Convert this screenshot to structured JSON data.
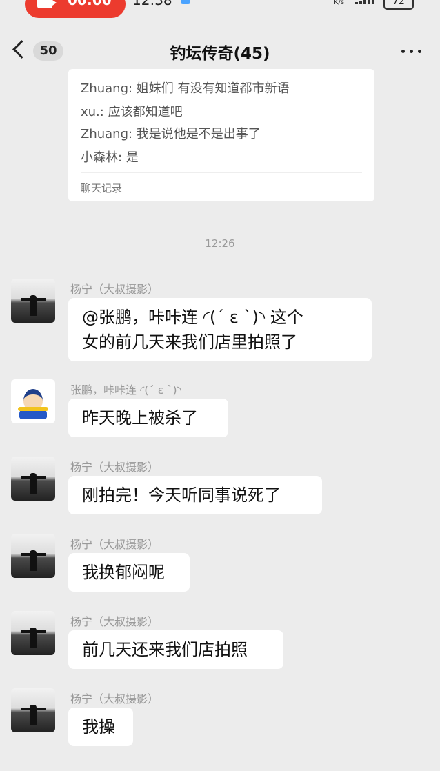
{
  "status_bar": {
    "rec_time": "00:00",
    "clock": "12:38",
    "net_speed": "K/s",
    "battery": "72"
  },
  "nav": {
    "back_badge": "50",
    "title": "钓坛传奇(45)"
  },
  "record": {
    "lines": [
      {
        "name": "Zhuang",
        "text": ": 姐妹们 有没有知道都市新语"
      },
      {
        "name": "xu.",
        "text": ": 应该都知道吧"
      },
      {
        "name": "Zhuang",
        "text": ": 我是说他是不是出事了"
      },
      {
        "name": "小森林",
        "text": ": 是"
      }
    ],
    "footer": "聊天记录"
  },
  "time_separator": "12:26",
  "messages": [
    {
      "sender": "杨宁（大叔摄影）",
      "lines": [
        "@张鹏，咔咔连 ◜(ˊ ε ˋ)◝ 这个",
        "女的前几天来我们店里拍照了"
      ],
      "avatar": "landscape"
    },
    {
      "sender": "张鹏，咔咔连 ◜(ˊ ε ˋ)◝",
      "lines": [
        "昨天晚上被杀了"
      ],
      "avatar": "cartoon"
    },
    {
      "sender": "杨宁（大叔摄影）",
      "lines": [
        "刚拍完！今天听同事说死了"
      ],
      "avatar": "landscape"
    },
    {
      "sender": "杨宁（大叔摄影）",
      "lines": [
        "我换郁闷呢"
      ],
      "avatar": "landscape"
    },
    {
      "sender": "杨宁（大叔摄影）",
      "lines": [
        "前几天还来我们店拍照"
      ],
      "avatar": "landscape"
    },
    {
      "sender": "杨宁（大叔摄影）",
      "lines": [
        "我操"
      ],
      "avatar": "landscape"
    }
  ],
  "colors": {
    "background": "#ececec",
    "bubble": "#ffffff",
    "record_pill": "#ec3b2e"
  }
}
